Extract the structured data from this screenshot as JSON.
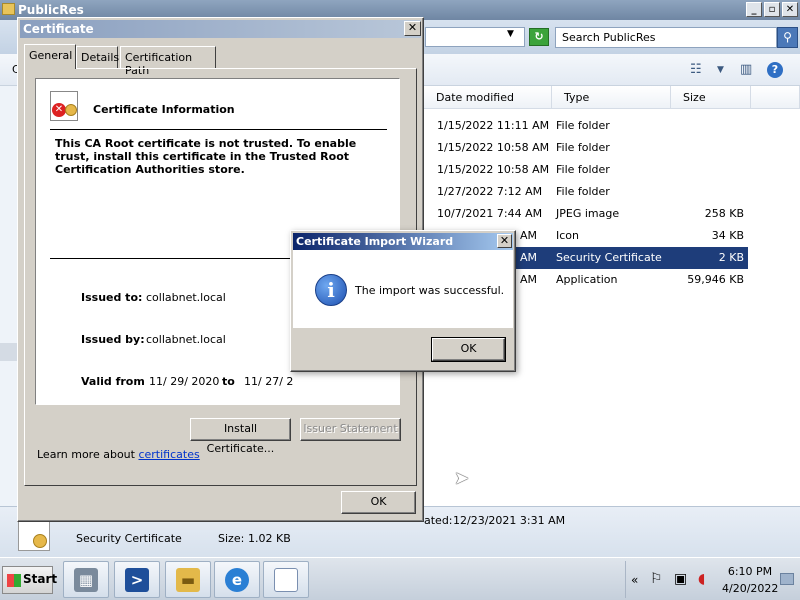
{
  "explorer": {
    "title": "PublicRes",
    "search_placeholder": "Search PublicRes",
    "partial_left_char": "C",
    "columns": [
      "Date modified",
      "Type",
      "Size"
    ],
    "rows": [
      {
        "date": "1/15/2022 11:11 AM",
        "type": "File folder",
        "size": ""
      },
      {
        "date": "1/15/2022 10:58 AM",
        "type": "File folder",
        "size": ""
      },
      {
        "date": "1/15/2022 10:58 AM",
        "type": "File folder",
        "size": ""
      },
      {
        "date": "1/27/2022 7:12 AM",
        "type": "File folder",
        "size": ""
      },
      {
        "date": "10/7/2021 7:44 AM",
        "type": "JPEG image",
        "size": "258 KB"
      },
      {
        "date": "AM",
        "type": "Icon",
        "size": "34 KB"
      },
      {
        "date": "AM",
        "type": "Security Certificate",
        "size": "2 KB"
      },
      {
        "date": "AM",
        "type": "Application",
        "size": "59,946 KB"
      }
    ],
    "details": {
      "file_type": "Security Certificate",
      "size_label": "Size:",
      "size_value": "1.02 KB",
      "created_fragment": "ated:",
      "created_value": "12/23/2021 3:31 AM"
    }
  },
  "cert_dialog": {
    "title": "Certificate",
    "tabs": [
      "General",
      "Details",
      "Certification Path"
    ],
    "info_heading": "Certificate Information",
    "warning": "This CA Root certificate is not trusted. To enable trust, install this certificate in the Trusted Root Certification Authorities store.",
    "issued_to_label": "Issued to:",
    "issued_to": "collabnet.local",
    "issued_by_label": "Issued by:",
    "issued_by": "collabnet.local",
    "valid_from_label": "Valid from",
    "valid_from": "11/ 29/ 2020",
    "to_label": "to",
    "valid_to": "11/ 27/ 2",
    "install_button": "Install Certificate...",
    "issuer_button": "Issuer Statement",
    "learn_more_prefix": "Learn more about ",
    "learn_more_link": "certificates",
    "ok_button": "OK"
  },
  "wizard": {
    "title": "Certificate Import Wizard",
    "message": "The import was successful.",
    "ok_button": "OK",
    "icon": "info-icon"
  },
  "taskbar": {
    "start": "Start",
    "time": "6:10 PM",
    "date": "4/20/2022",
    "tray_chevron": "«"
  },
  "colors": {
    "selection": "#1e3d7a",
    "link": "#0033cc",
    "wizard_title": "#0a246a"
  }
}
